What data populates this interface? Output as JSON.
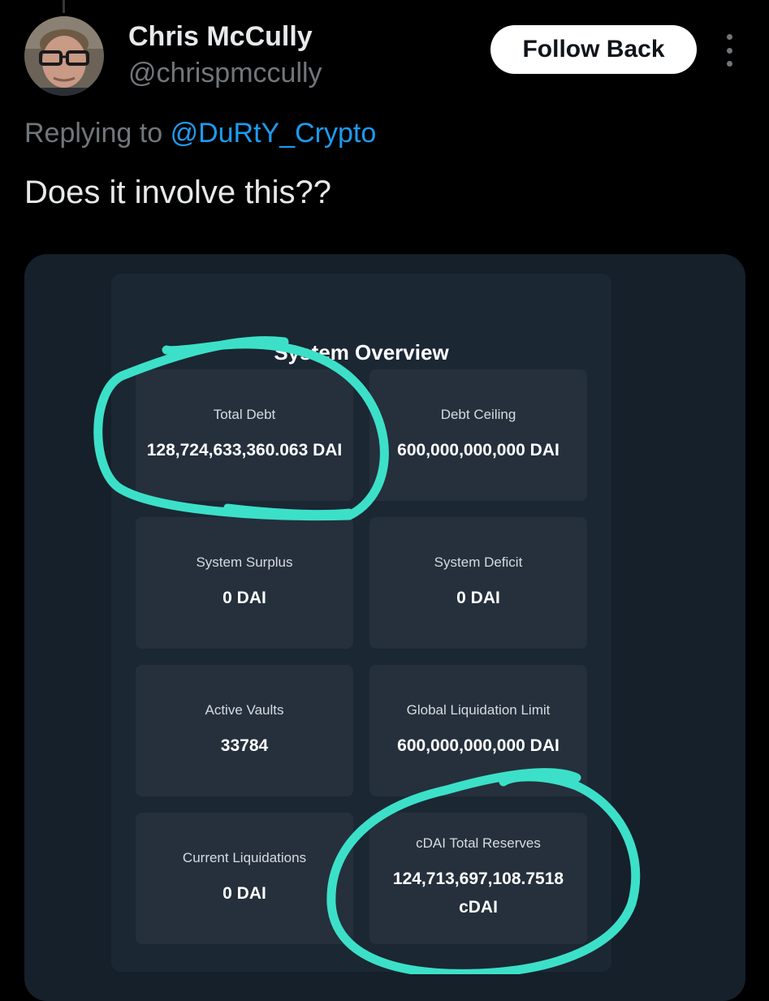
{
  "tweet": {
    "author": {
      "display_name": "Chris McCully",
      "handle": "@chrispmccully"
    },
    "follow_label": "Follow Back",
    "replying_to_prefix": "Replying to",
    "replying_to_handle": "@DuRtY_Crypto",
    "text": "Does it involve this??",
    "colors": {
      "background": "#000000",
      "link": "#1d9bf0",
      "secondary_text": "#71767b",
      "annotation_circle": "#3ce0c8"
    }
  },
  "overview": {
    "title": "System Overview",
    "cards": [
      {
        "label": "Total Debt",
        "value": "128,724,633,360.063 DAI"
      },
      {
        "label": "Debt Ceiling",
        "value": "600,000,000,000 DAI"
      },
      {
        "label": "System Surplus",
        "value": "0 DAI"
      },
      {
        "label": "System Deficit",
        "value": "0 DAI"
      },
      {
        "label": "Active Vaults",
        "value": "33784"
      },
      {
        "label": "Global Liquidation Limit",
        "value": "600,000,000,000 DAI"
      },
      {
        "label": "Current Liquidations",
        "value": "0 DAI"
      },
      {
        "label": "cDAI Total Reserves",
        "value": "124,713,697,108.7518 cDAI"
      }
    ]
  }
}
